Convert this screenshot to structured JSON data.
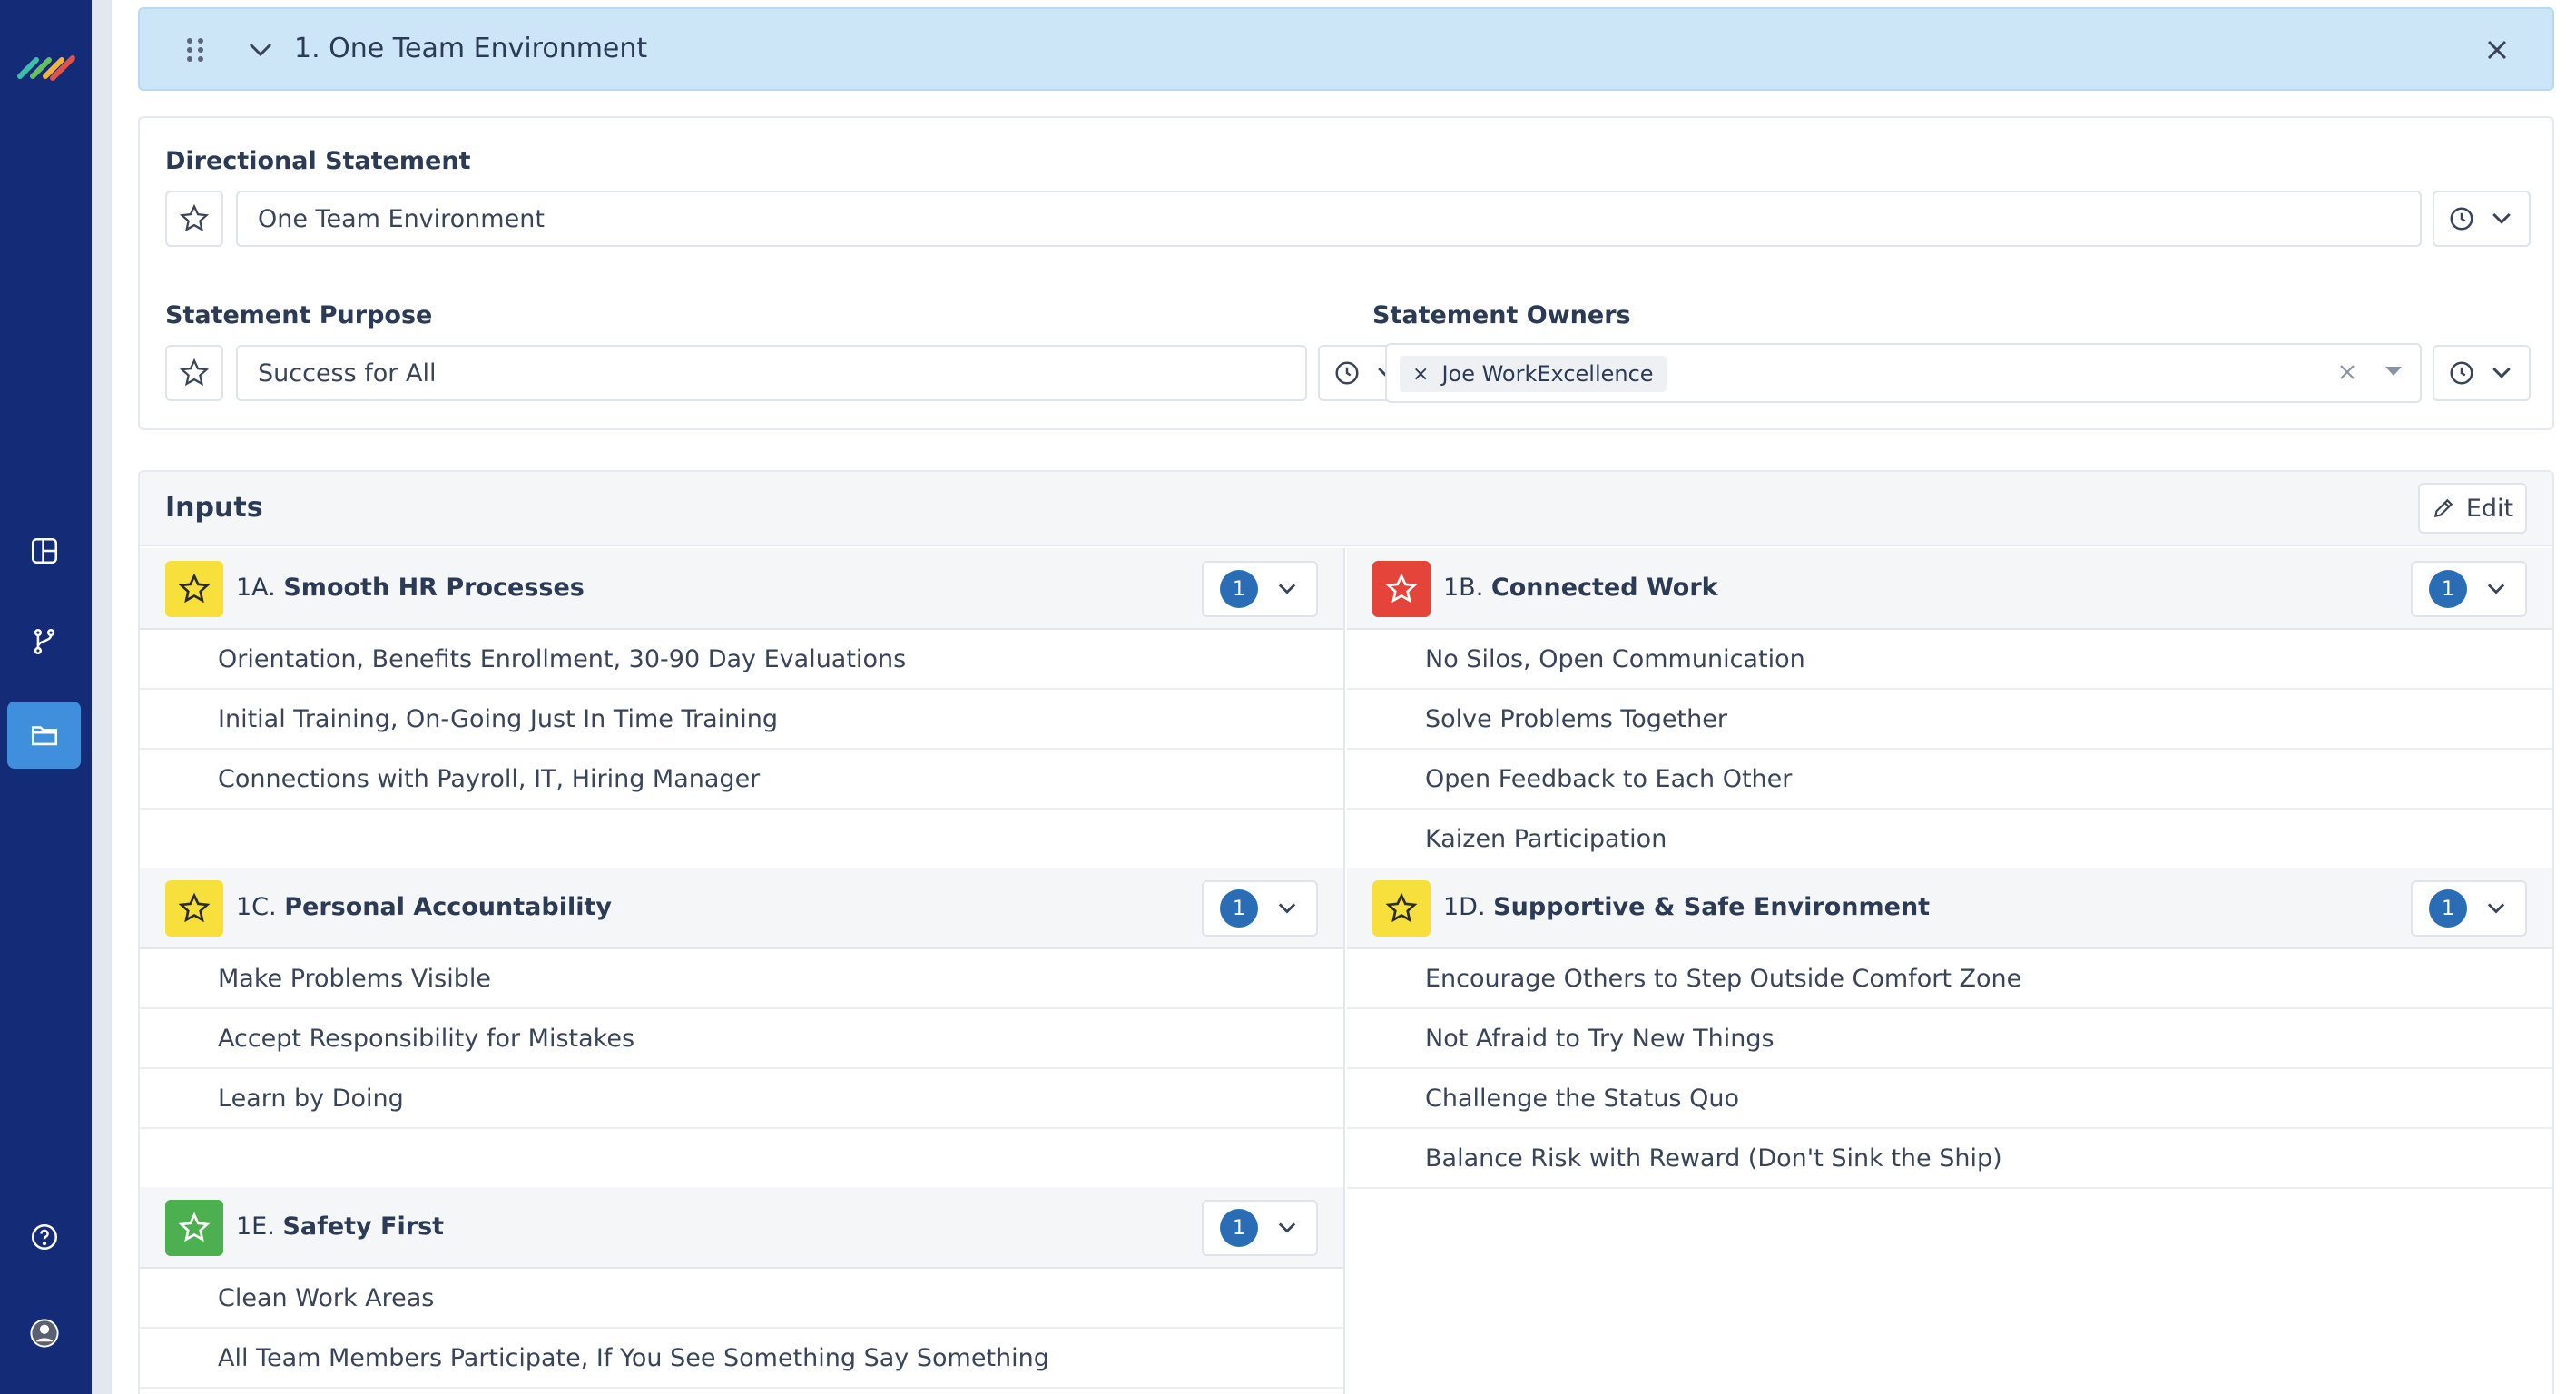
{
  "header": {
    "title": "1. One Team Environment"
  },
  "statement": {
    "directional_label": "Directional Statement",
    "directional_value": "One Team Environment",
    "purpose_label": "Statement Purpose",
    "purpose_value": "Success for All",
    "owners_label": "Statement Owners",
    "owner_tag": "Joe WorkExcellence",
    "owner_tag_remove": "×"
  },
  "inputs": {
    "title": "Inputs",
    "edit_label": "Edit",
    "groups": [
      {
        "code": "1A.",
        "name": "Smooth HR Processes",
        "star_color": "#f7e03c",
        "count": "1",
        "items": [
          "Orientation, Benefits Enrollment, 30-90 Day Evaluations",
          "Initial Training, On-Going Just In Time Training",
          "Connections with Payroll, IT, Hiring Manager"
        ]
      },
      {
        "code": "1B.",
        "name": "Connected Work",
        "star_color": "#e4443a",
        "count": "1",
        "items": [
          "No Silos, Open Communication",
          "Solve Problems Together",
          "Open Feedback to Each Other",
          "Kaizen Participation"
        ]
      },
      {
        "code": "1C.",
        "name": "Personal Accountability",
        "star_color": "#f7e03c",
        "count": "1",
        "items": [
          "Make Problems Visible",
          "Accept Responsibility for Mistakes",
          "Learn by Doing"
        ]
      },
      {
        "code": "1D.",
        "name": "Supportive & Safe Environment",
        "star_color": "#f7e03c",
        "count": "1",
        "items": [
          "Encourage Others to Step Outside Comfort Zone",
          "Not Afraid to Try New Things",
          "Challenge the Status Quo",
          "Balance Risk with Reward (Don't Sink the Ship)"
        ]
      },
      {
        "code": "1E.",
        "name": "Safety First",
        "star_color": "#4caf50",
        "count": "1",
        "items": [
          "Clean Work Areas",
          "All Team Members Participate, If You See Something Say Something"
        ]
      }
    ]
  },
  "sidebar": {
    "accent_color": "#142b78",
    "active_color": "#3f8fdc",
    "icons": [
      "layout-icon",
      "branch-icon",
      "folder-icon",
      "help-icon",
      "user-avatar-icon"
    ]
  }
}
